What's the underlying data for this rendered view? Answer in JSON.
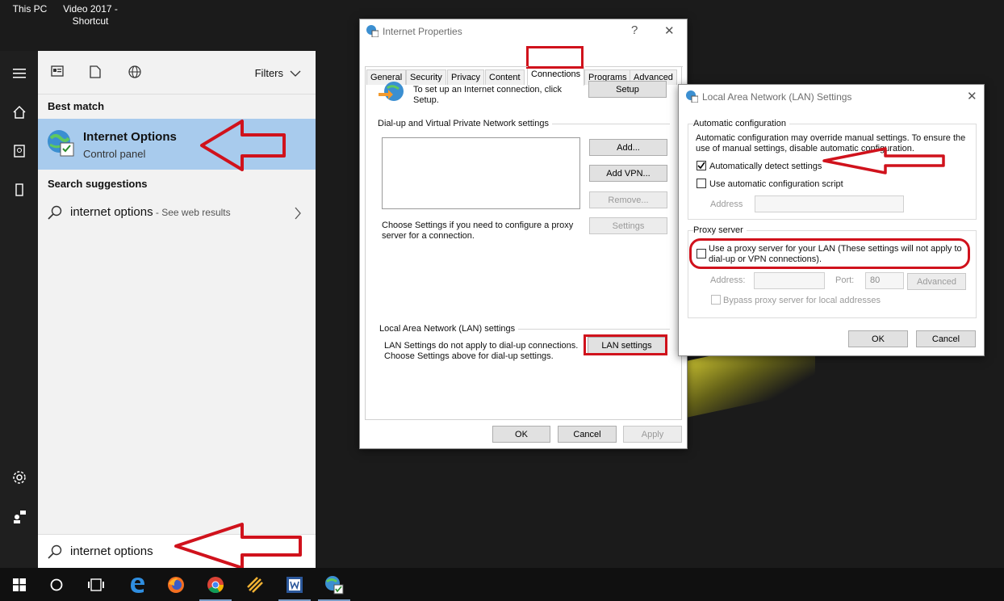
{
  "desktop": {
    "this_pc": "This PC",
    "shortcut_line1": "Video 2017 -",
    "shortcut_line2": "Shortcut"
  },
  "start_menu": {
    "filters_label": "Filters",
    "best_match_heading": "Best match",
    "best_match_title": "Internet Options",
    "best_match_subtitle": "Control panel",
    "search_suggestions_heading": "Search suggestions",
    "suggestion_query": "internet options",
    "suggestion_hint": " - See web results",
    "search_value": "internet options"
  },
  "internet_properties": {
    "title": "Internet Properties",
    "help": "?",
    "tabs": [
      "General",
      "Security",
      "Privacy",
      "Content",
      "Connections",
      "Programs",
      "Advanced"
    ],
    "setup_text_line1": "To set up an Internet connection, click",
    "setup_text_line2": "Setup.",
    "setup_button": "Setup",
    "dialup_group": "Dial-up and Virtual Private Network settings",
    "add_button": "Add...",
    "add_vpn_button": "Add VPN...",
    "remove_button": "Remove...",
    "settings_button": "Settings",
    "proxy_hint_line1": "Choose Settings if you need to configure a proxy",
    "proxy_hint_line2": "server for a connection.",
    "lan_group": "Local Area Network (LAN) settings",
    "lan_text_line1": "LAN Settings do not apply to dial-up connections.",
    "lan_text_line2": "Choose Settings above for dial-up settings.",
    "lan_button": "LAN settings",
    "ok": "OK",
    "cancel": "Cancel",
    "apply": "Apply"
  },
  "lan_settings": {
    "title": "Local Area Network (LAN) Settings",
    "auto_group": "Automatic configuration",
    "auto_text_line1": "Automatic configuration may override manual settings.  To ensure the",
    "auto_text_line2": "use of manual settings, disable automatic configuration.",
    "auto_detect_label": "Automatically detect settings",
    "auto_detect_checked": true,
    "use_script_label": "Use automatic configuration script",
    "use_script_checked": false,
    "address_label": "Address",
    "proxy_group": "Proxy server",
    "use_proxy_line1": "Use a proxy server for your LAN (These settings will not apply to",
    "use_proxy_line2": "dial-up or VPN connections).",
    "use_proxy_checked": false,
    "proxy_address_label": "Address:",
    "port_label": "Port:",
    "port_value": "80",
    "advanced_button": "Advanced",
    "bypass_label": "Bypass proxy server for local addresses",
    "ok": "OK",
    "cancel": "Cancel"
  },
  "colors": {
    "annotation_red": "#d0121c",
    "selection_blue": "#a8cbed",
    "taskbar": "#101010"
  }
}
